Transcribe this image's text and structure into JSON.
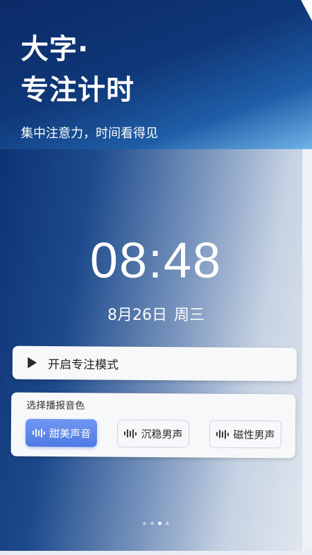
{
  "header": {
    "title_line1": "大字·",
    "title_line2": "专注计时",
    "subtitle": "集中注意力，时间看得见"
  },
  "clock": {
    "time": "08:48",
    "date": "8月26日",
    "weekday": "周三"
  },
  "focus": {
    "button_label": "开启专注模式",
    "icon": "play-icon"
  },
  "voice": {
    "title": "选择播报音色",
    "options": [
      {
        "label": "甜美声音",
        "selected": true,
        "icon": "sound-wave-icon"
      },
      {
        "label": "沉稳男声",
        "selected": false,
        "icon": "sound-wave-icon"
      },
      {
        "label": "磁性男声",
        "selected": false,
        "icon": "sound-wave-icon"
      }
    ],
    "accent_color": "#5b84ec"
  },
  "pager": {
    "total": 4,
    "active_index": 2
  }
}
